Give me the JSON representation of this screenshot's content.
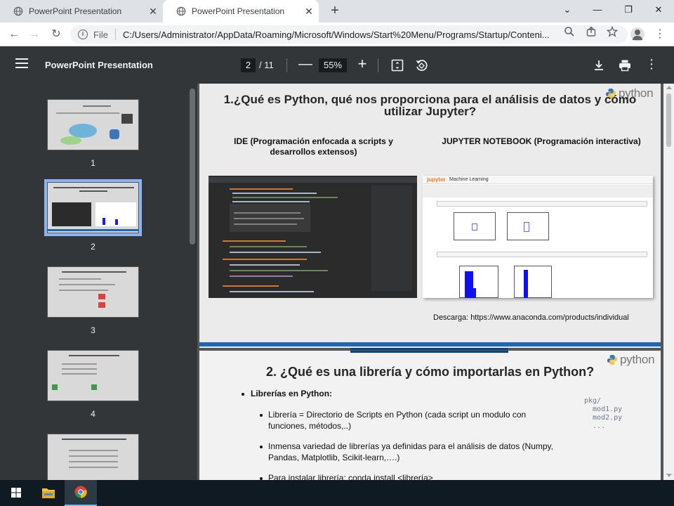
{
  "browser": {
    "tabs": [
      {
        "title": "PowerPoint Presentation",
        "active": false
      },
      {
        "title": "PowerPoint Presentation",
        "active": true
      }
    ],
    "new_tab": "+",
    "window_controls": {
      "minimize": "—",
      "restore": "❐",
      "close": "✕",
      "tab_search": "⌄"
    },
    "address": {
      "scheme_label": "File",
      "url": "C:/Users/Administrator/AppData/Roaming/Microsoft/Windows/Start%20Menu/Programs/Startup/Conteni..."
    }
  },
  "pdf_viewer": {
    "title": "PowerPoint Presentation",
    "current_page": "2",
    "total_pages": "/ 11",
    "zoom": "55%",
    "zoom_out": "—",
    "zoom_in": "+"
  },
  "thumbnails": [
    {
      "number": "1",
      "selected": false
    },
    {
      "number": "2",
      "selected": true
    },
    {
      "number": "3",
      "selected": false
    },
    {
      "number": "4",
      "selected": false
    }
  ],
  "slide1": {
    "logo": "python",
    "title_line1": "1.¿Qué es Python, qué nos proporciona para el análisis de datos y cómo",
    "title_line2": "utilizar Jupyter?",
    "left_heading_line1": "IDE (Programación enfocada a scripts y",
    "left_heading_line2": "desarrollos extensos)",
    "right_heading": "JUPYTER NOTEBOOK (Programación interactiva)",
    "download": "Descarga: https://www.anaconda.com/products/individual",
    "jupyter_label": "jupyter",
    "jupyter_notebook": "Machine Learning"
  },
  "slide2": {
    "logo": "python",
    "title": "2. ¿Qué es una librería y cómo importarlas en Python?",
    "bullet_main": "Librerías en Python:",
    "sub1_line1": "Librería = Directorio de Scripts en Python (cada script un modulo con",
    "sub1_line2": "funciones, métodos,..)",
    "sub2_line1": "Inmensa variedad de librerías ya definidas para el análisis de datos (Numpy,",
    "sub2_line2": "Pandas, Matplotlib, Scikit-learn,….)",
    "sub3": "Para instalar librería: conda install <librería>",
    "code": "pkg/\n  mod1.py\n  mod2.py\n  ..."
  },
  "colors": {
    "accent_blue": "#1f66b4",
    "selected_thumb": "#8ab4f8",
    "viewer_bg": "#323639"
  }
}
